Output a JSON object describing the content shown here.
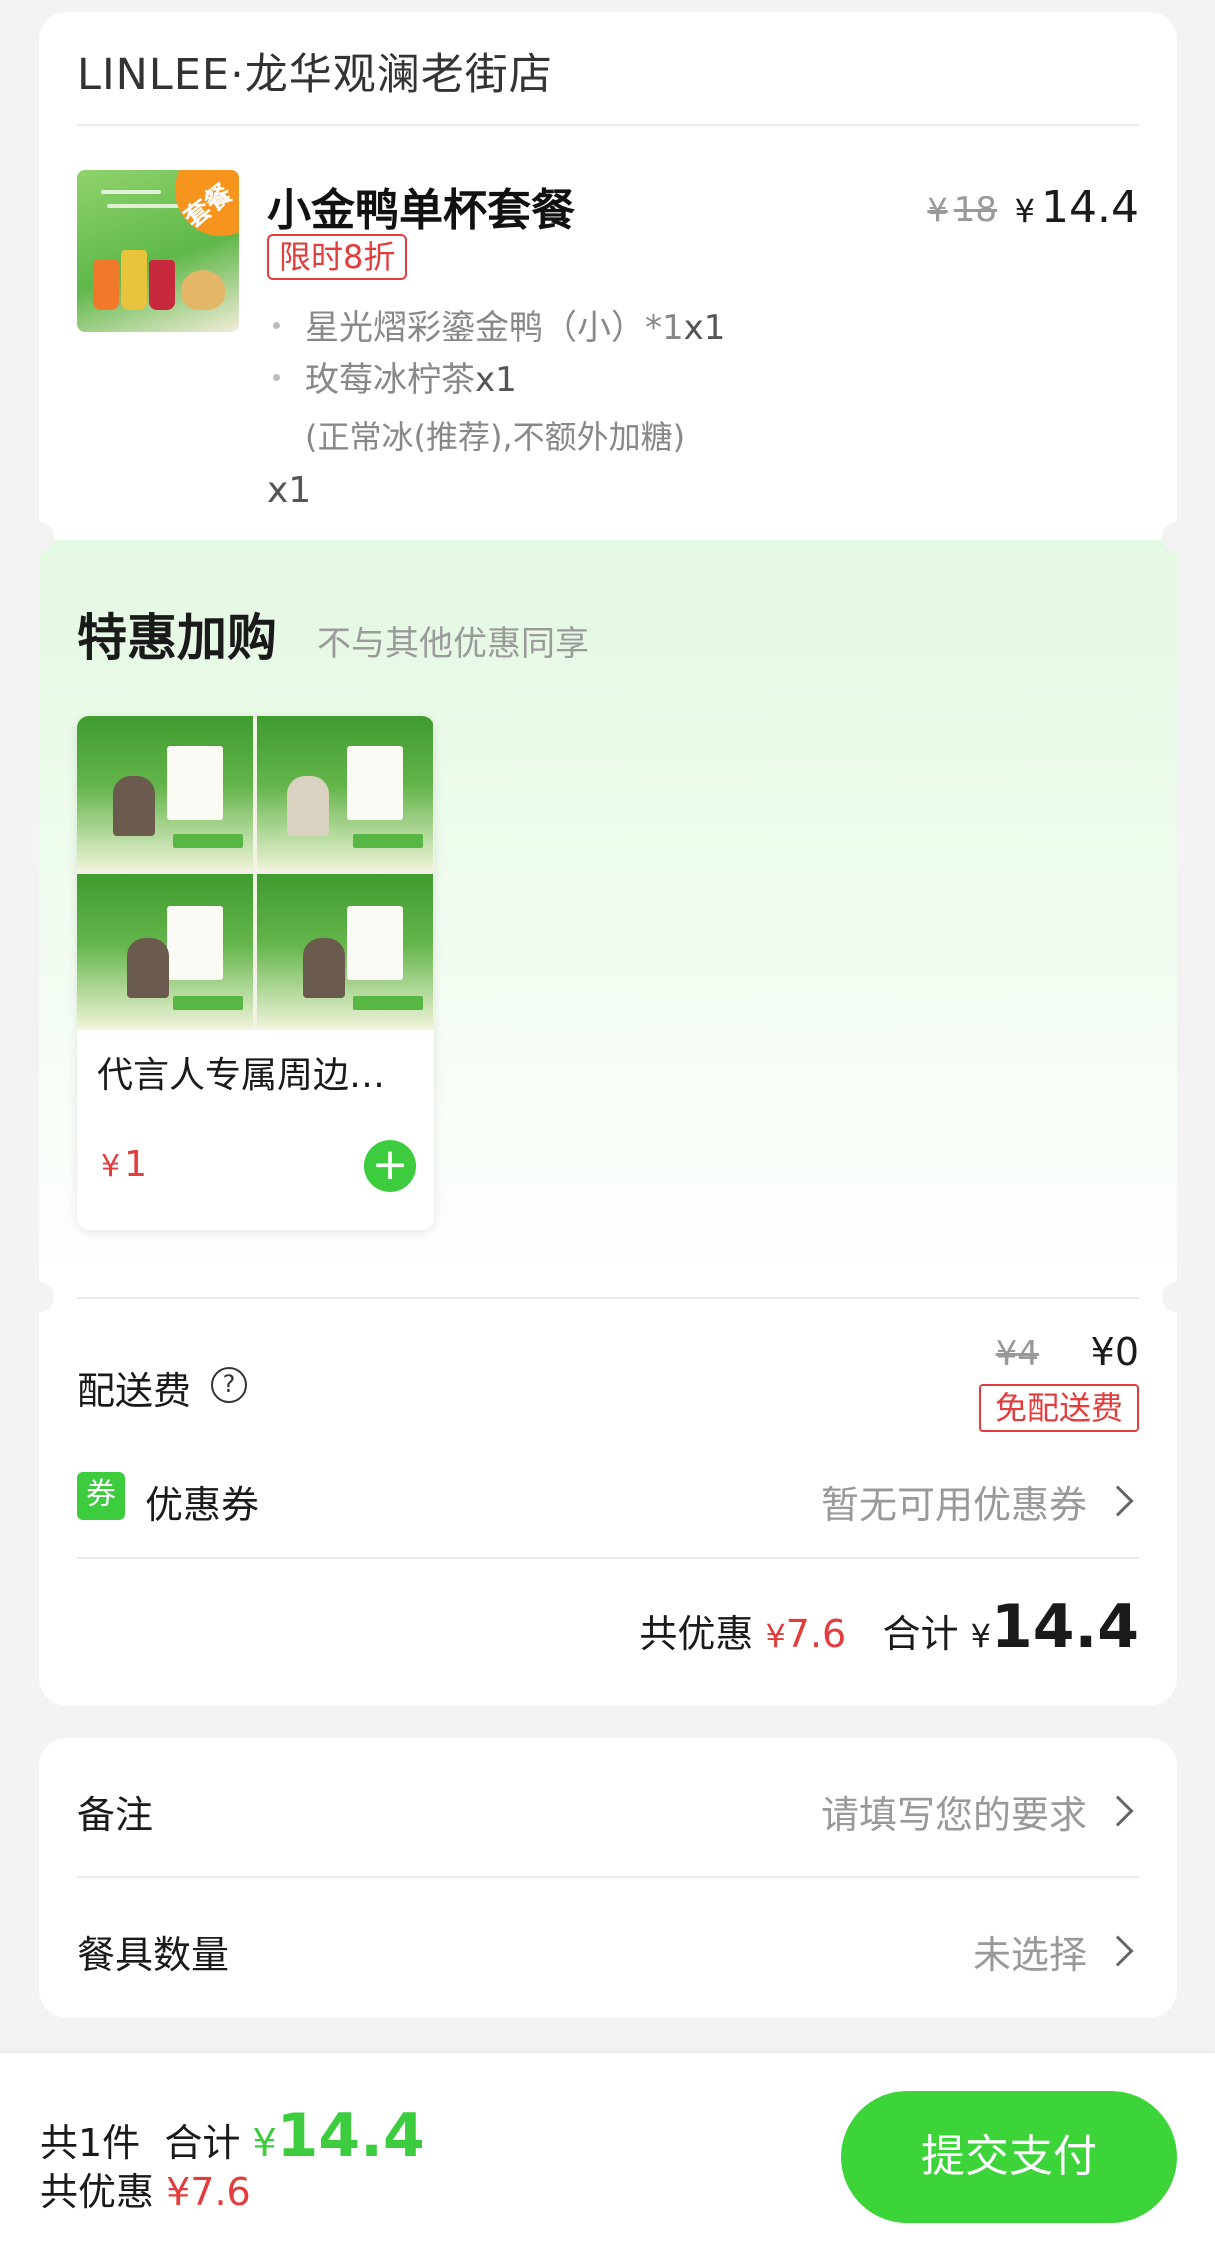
{
  "store": {
    "name": "LINLEE·龙华观澜老街店"
  },
  "product": {
    "image_tag": "套餐",
    "title": "小金鸭单杯套餐",
    "badge": "限时8折",
    "price_original": "18",
    "price_current": "14.4",
    "currency": "¥",
    "items": [
      {
        "name": "星光熠彩鎏金鸭（小）*1",
        "qty": "x1"
      },
      {
        "name": "玫莓冰柠茶",
        "qty": "x1"
      }
    ],
    "spec": "(正常冰(推荐),不额外加糖)",
    "quantity": "x1"
  },
  "addon": {
    "title": "特惠加购",
    "subtitle": "不与其他优惠同享",
    "items": [
      {
        "name": "代言人专属周边组合",
        "price": "1"
      }
    ]
  },
  "fees": {
    "delivery_label": "配送费",
    "delivery_original": "4",
    "delivery_current": "0",
    "delivery_badge": "免配送费",
    "coupon_icon_text": "券",
    "coupon_label": "优惠券",
    "coupon_value": "暂无可用优惠券"
  },
  "summary": {
    "discount_label": "共优惠",
    "discount_value": "7.6",
    "total_label": "合计",
    "total_value": "14.4"
  },
  "notes": {
    "remark_label": "备注",
    "remark_placeholder": "请填写您的要求",
    "tableware_label": "餐具数量",
    "tableware_value": "未选择"
  },
  "bottom_bar": {
    "count_text": "共1件",
    "total_label": "合计",
    "total_value": "14.4",
    "discount_label": "共优惠",
    "discount_value": "7.6",
    "submit_label": "提交支付"
  },
  "colors": {
    "accent_green": "#3dcc3d",
    "discount_red": "#e23c3c",
    "tag_orange": "#f7941d"
  }
}
